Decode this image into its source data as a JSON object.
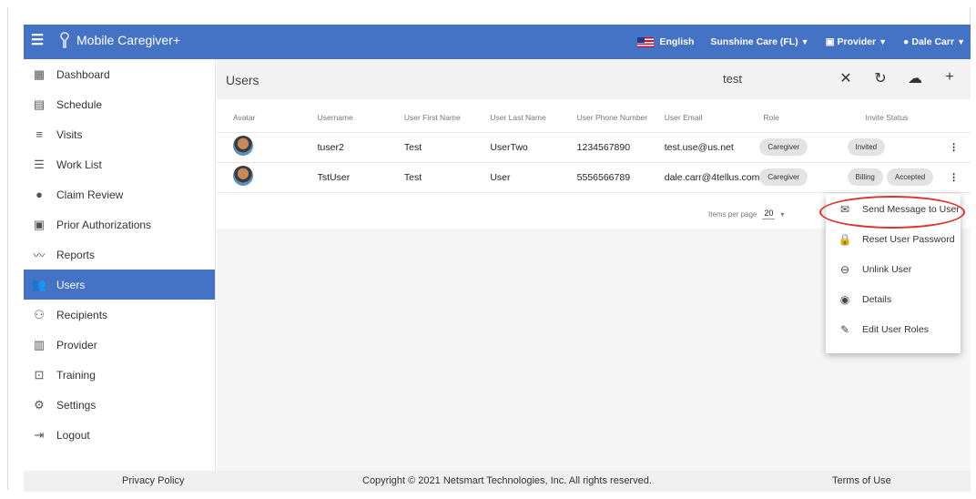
{
  "topbar": {
    "app_name": "Mobile Caregiver+",
    "language": "English",
    "agency": "Sunshine Care (FL)",
    "role": "Provider",
    "user": "Dale Carr"
  },
  "sidebar": {
    "items": [
      {
        "label": "Dashboard",
        "icon": "dashboard-icon"
      },
      {
        "label": "Schedule",
        "icon": "calendar-icon"
      },
      {
        "label": "Visits",
        "icon": "filter-icon"
      },
      {
        "label": "Work List",
        "icon": "list-icon"
      },
      {
        "label": "Claim Review",
        "icon": "alert-icon"
      },
      {
        "label": "Prior Authorizations",
        "icon": "calendar-icon"
      },
      {
        "label": "Reports",
        "icon": "trending-icon"
      },
      {
        "label": "Users",
        "icon": "users-icon",
        "active": true
      },
      {
        "label": "Recipients",
        "icon": "recipients-icon"
      },
      {
        "label": "Provider",
        "icon": "clipboard-icon"
      },
      {
        "label": "Training",
        "icon": "training-icon"
      },
      {
        "label": "Settings",
        "icon": "gear-icon"
      },
      {
        "label": "Logout",
        "icon": "logout-icon"
      }
    ]
  },
  "main": {
    "title": "Users",
    "search_value": "test",
    "columns": [
      "Avatar",
      "Username",
      "User First Name",
      "User Last Name",
      "User Phone Number",
      "User Email",
      "Role",
      "Invite Status"
    ],
    "rows": [
      {
        "username": "tuser2",
        "first": "Test",
        "last": "UserTwo",
        "phone": "1234567890",
        "email": "test.use@us.net",
        "roles": [
          "Caregiver"
        ],
        "status": "Invited"
      },
      {
        "username": "TstUser",
        "first": "Test",
        "last": "User",
        "phone": "5556566789",
        "email": "dale.carr@4tellus.com",
        "roles": [
          "Caregiver",
          "Billing"
        ],
        "status": "Accepted"
      }
    ],
    "pager": {
      "label": "Items per page",
      "value": "20"
    }
  },
  "context_menu": {
    "items": [
      {
        "label": "Send Message to User",
        "icon": "mail-icon"
      },
      {
        "label": "Reset User Password",
        "icon": "lock-icon"
      },
      {
        "label": "Unlink User",
        "icon": "link-icon"
      },
      {
        "label": "Details",
        "icon": "eye-icon"
      },
      {
        "label": "Edit User Roles",
        "icon": "pencil-icon"
      }
    ]
  },
  "footer": {
    "privacy": "Privacy Policy",
    "copyright": "Copyright © 2021 Netsmart Technologies, Inc. All rights reserved.",
    "terms": "Terms of Use"
  },
  "colors": {
    "primary": "#4472c4",
    "highlight": "#e03030"
  }
}
